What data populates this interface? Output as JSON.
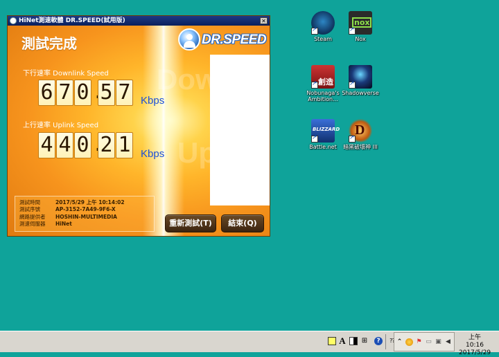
{
  "window": {
    "title": "HiNet測速軟體 DR.SPEED(試用版)",
    "close_glyph": "✕",
    "status": "測試完成",
    "logo_text": "DR.SPEED",
    "downlink": {
      "label": "下行速率 Downlink  Speed",
      "int_digits": [
        "6",
        "7",
        "0"
      ],
      "separator": ".",
      "dec_digits": [
        "5",
        "7"
      ],
      "unit": "Kbps",
      "value": 670.57
    },
    "uplink": {
      "label": "上行速率 Uplink Speed",
      "int_digits": [
        "4",
        "4",
        "0"
      ],
      "separator": ".",
      "dec_digits": [
        "2",
        "1"
      ],
      "unit": "Kbps",
      "value": 440.21
    },
    "watermark": {
      "line1": "Downli",
      "line2": "Up"
    },
    "info": [
      {
        "key": "測試時間",
        "value": "2017/5/29 上午 10:14:02"
      },
      {
        "key": "測試序號",
        "value": "AP-3152-7A49-9F6-X"
      },
      {
        "key": "網路提供者",
        "value": "HOSHIN-MULTIMEDIA"
      },
      {
        "key": "測速伺服器",
        "value": "HiNet"
      }
    ],
    "buttons": {
      "retest": "重新測試(T)",
      "close": "結束(Q)"
    }
  },
  "desktop_icons": [
    {
      "id": "steam",
      "label": "Steam"
    },
    {
      "id": "nox",
      "label": "Nox",
      "glyph": "nox"
    },
    {
      "id": "nobunaga",
      "label": "Nobunaga's Ambition...",
      "glyph": "創造"
    },
    {
      "id": "shadowverse",
      "label": "Shadowverse"
    },
    {
      "id": "battlenet",
      "label": "Battle.net",
      "glyph": "BLIZZARD"
    },
    {
      "id": "diablo",
      "label": "暗黑破壞神 III",
      "glyph": "D"
    }
  ],
  "taskbar": {
    "ime_letter": "A",
    "help": "?",
    "clock_time": "上午 10:16",
    "clock_date": "2017/5/29"
  },
  "colors": {
    "desktop": "#0fa39a",
    "window_orange": "#f5a31a",
    "unit_blue": "#1a4fd8",
    "titlebar": "#0a1f5c"
  }
}
